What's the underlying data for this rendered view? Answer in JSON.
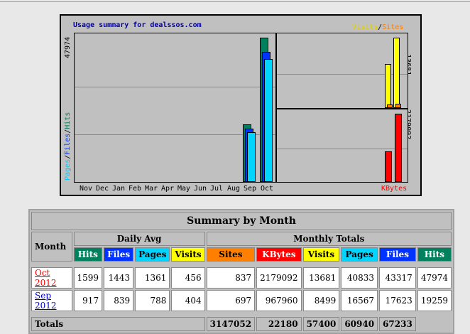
{
  "chart": {
    "title": "Usage summary for dealssos.com",
    "legend_visits": "Visits",
    "legend_sep": "/",
    "legend_sites": "Sites",
    "legend_kbytes": "KBytes",
    "y_left_max": "47974",
    "y_left_label_pages": "Pages",
    "y_left_label_files": "Files",
    "y_left_label_hits": "Hits",
    "y_left_sep": "/",
    "y_right_top_max": "13681",
    "y_right_bottom_max": "2179092",
    "months": [
      "Nov",
      "Dec",
      "Jan",
      "Feb",
      "Mar",
      "Apr",
      "May",
      "Jun",
      "Jul",
      "Aug",
      "Sep",
      "Oct"
    ],
    "colors": {
      "hits": "#00805c",
      "files": "#0033ff",
      "pages": "#00d4ff",
      "visits": "#ffff00",
      "sites": "#ff8000",
      "kbytes": "#ff0000"
    }
  },
  "chart_data": {
    "type": "bar",
    "categories": [
      "Nov",
      "Dec",
      "Jan",
      "Feb",
      "Mar",
      "Apr",
      "May",
      "Jun",
      "Jul",
      "Aug",
      "Sep",
      "Oct"
    ],
    "series": [
      {
        "name": "Hits",
        "values": [
          0,
          0,
          0,
          0,
          0,
          0,
          0,
          0,
          0,
          0,
          19259,
          47974
        ]
      },
      {
        "name": "Files",
        "values": [
          0,
          0,
          0,
          0,
          0,
          0,
          0,
          0,
          0,
          0,
          17623,
          43317
        ]
      },
      {
        "name": "Pages",
        "values": [
          0,
          0,
          0,
          0,
          0,
          0,
          0,
          0,
          0,
          0,
          16567,
          40833
        ]
      },
      {
        "name": "Visits",
        "values": [
          8499,
          13681
        ]
      },
      {
        "name": "Sites",
        "values": [
          697,
          837
        ]
      },
      {
        "name": "KBytes",
        "values": [
          967960,
          2179092
        ]
      }
    ],
    "title": "Usage summary for dealssos.com",
    "ylim_left": [
      0,
      47974
    ],
    "ylim_right_top": [
      0,
      13681
    ],
    "ylim_right_bottom": [
      0,
      2179092
    ]
  },
  "table": {
    "title": "Summary by Month",
    "month_header": "Month",
    "daily_avg": "Daily Avg",
    "monthly_totals": "Monthly Totals",
    "daily_cols": [
      "Hits",
      "Files",
      "Pages",
      "Visits"
    ],
    "monthly_cols": [
      "Sites",
      "KBytes",
      "Visits",
      "Pages",
      "Files",
      "Hits"
    ],
    "rows": [
      {
        "month": "Oct 2012",
        "vals": [
          "1599",
          "1443",
          "1361",
          "456",
          "837",
          "2179092",
          "13681",
          "40833",
          "43317",
          "47974"
        ]
      },
      {
        "month": "Sep 2012",
        "vals": [
          "917",
          "839",
          "788",
          "404",
          "697",
          "967960",
          "8499",
          "16567",
          "17623",
          "19259"
        ]
      }
    ],
    "totals_label": "Totals",
    "totals": [
      "3147052",
      "22180",
      "57400",
      "60940",
      "67233"
    ]
  }
}
